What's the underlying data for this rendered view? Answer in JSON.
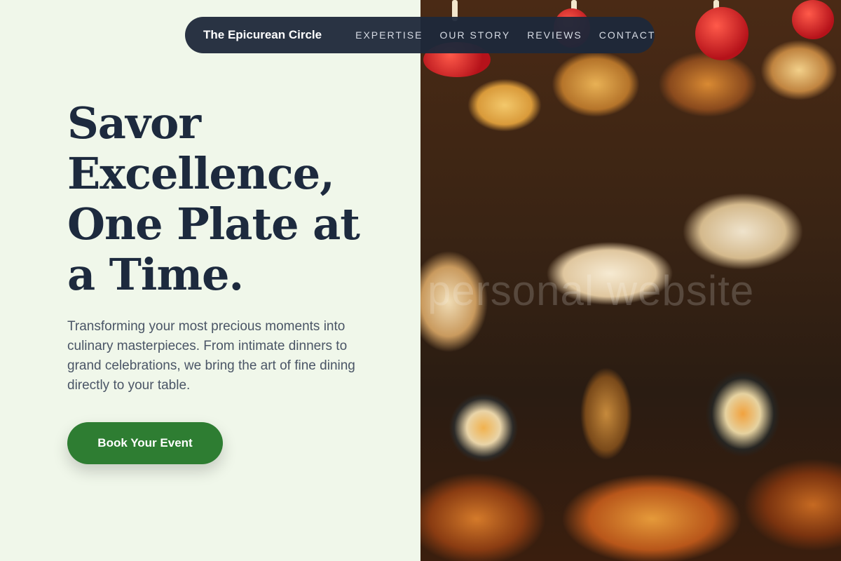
{
  "nav": {
    "brand": "The Epicurean Circle",
    "links": [
      "EXPERTISE",
      "OUR STORY",
      "REVIEWS",
      "CONTACT"
    ]
  },
  "hero": {
    "headline": "Savor Excellence, One Plate at a Time.",
    "subtext": "Transforming your most precious moments into culinary masterpieces. From intimate dinners to grand celebrations, we bring the art of fine dining directly to your table.",
    "cta_label": "Book Your Event"
  },
  "image": {
    "description_icon": "food-photo",
    "watermark": "personal website"
  },
  "colors": {
    "background": "#f0f7ea",
    "nav_bg": "#1e283a",
    "headline": "#1d2a3e",
    "cta": "#2e7d32"
  }
}
